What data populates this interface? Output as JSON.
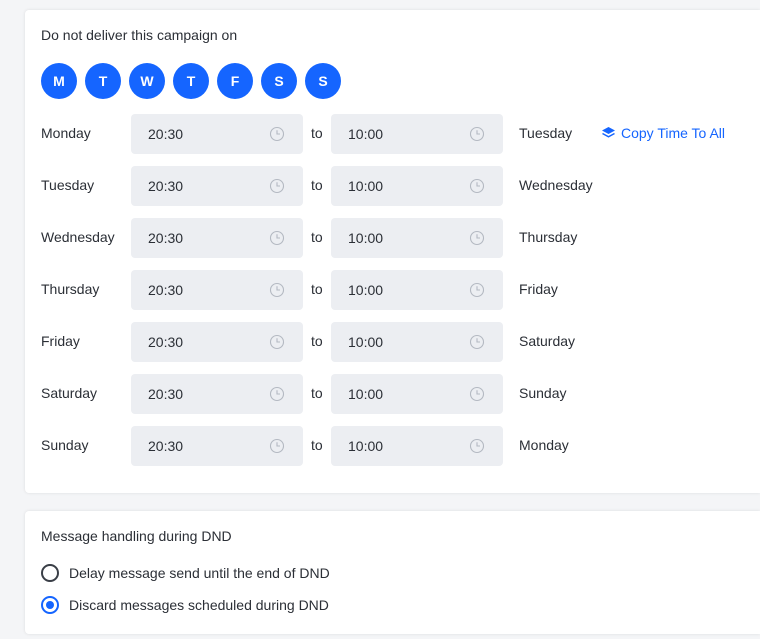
{
  "dnd": {
    "title": "Do not deliver this campaign on",
    "days": [
      "M",
      "T",
      "W",
      "T",
      "F",
      "S",
      "S"
    ],
    "to_label": "to",
    "copy_label": "Copy Time To All",
    "rows": [
      {
        "day": "Monday",
        "from": "20:30",
        "to": "10:00",
        "next_day": "Tuesday"
      },
      {
        "day": "Tuesday",
        "from": "20:30",
        "to": "10:00",
        "next_day": "Wednesday"
      },
      {
        "day": "Wednesday",
        "from": "20:30",
        "to": "10:00",
        "next_day": "Thursday"
      },
      {
        "day": "Thursday",
        "from": "20:30",
        "to": "10:00",
        "next_day": "Friday"
      },
      {
        "day": "Friday",
        "from": "20:30",
        "to": "10:00",
        "next_day": "Saturday"
      },
      {
        "day": "Saturday",
        "from": "20:30",
        "to": "10:00",
        "next_day": "Sunday"
      },
      {
        "day": "Sunday",
        "from": "20:30",
        "to": "10:00",
        "next_day": "Monday"
      }
    ]
  },
  "handling": {
    "title": "Message handling during DND",
    "options": [
      {
        "label": "Delay message send until the end of DND",
        "checked": false
      },
      {
        "label": "Discard messages scheduled during DND",
        "checked": true
      }
    ]
  },
  "colors": {
    "accent": "#1565ff",
    "input_bg": "#eceef2"
  }
}
